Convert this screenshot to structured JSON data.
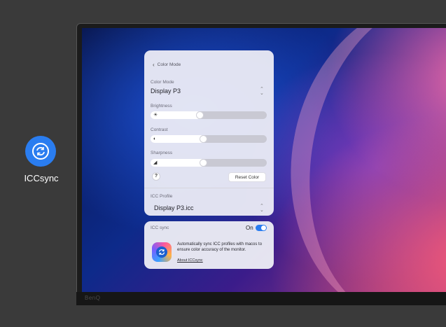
{
  "app": {
    "label": "ICCsync",
    "icon": "sync-icon"
  },
  "monitor": {
    "brand": "BenQ"
  },
  "panel": {
    "back_label": "Color Mode",
    "color_mode": {
      "label": "Color Mode",
      "value": "Display P3"
    },
    "brightness": {
      "label": "Brightness",
      "level": 0.44
    },
    "contrast": {
      "label": "Contrast",
      "level": 0.47
    },
    "sharpness": {
      "label": "Sharpness",
      "level": 0.47
    },
    "help_label": "?",
    "reset_label": "Reset Color",
    "icc_profile": {
      "label": "ICC Profile",
      "value": "Display P3.icc"
    }
  },
  "sync": {
    "title": "ICC sync",
    "toggle_label": "On",
    "toggle_on": true,
    "description": "Automatically sync ICC profiles with macos to ensure color accuracy of the monitor.",
    "link": "About ICCsync"
  },
  "colors": {
    "accent": "#2a7df0"
  }
}
